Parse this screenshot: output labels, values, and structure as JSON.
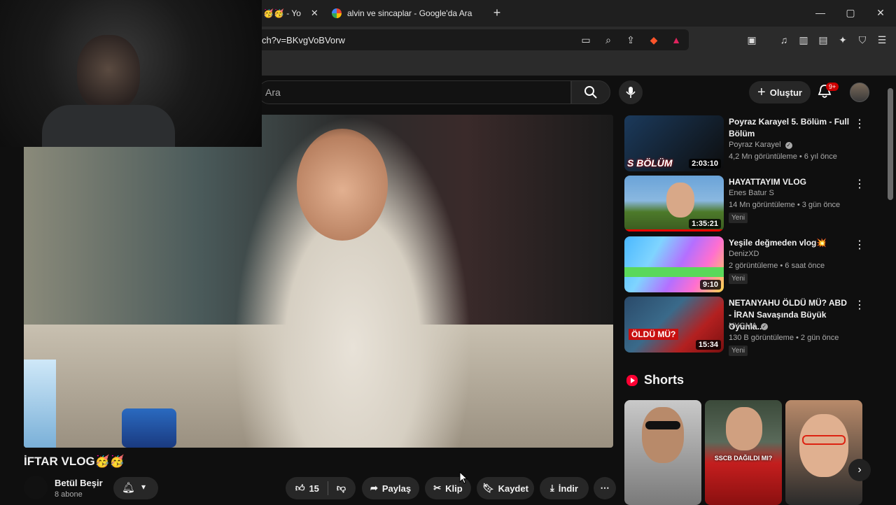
{
  "browser": {
    "tabs": [
      {
        "label": "🥳🥳 - Yo"
      },
      {
        "label": "alvin ve sincaplar - Google'da Ara"
      }
    ],
    "url": "ch?v=BKvgVoBVorw",
    "add_tab": "+",
    "window_controls": [
      "—",
      "▢",
      "✕"
    ]
  },
  "yt_header": {
    "search_placeholder": "Ara",
    "create_label": "Oluştur",
    "notif_count": "9+"
  },
  "video": {
    "title": "İFTAR VLOG🥳🥳",
    "channel": "Betül Beşir",
    "subscribers": "8 abone",
    "likes": "15",
    "actions": {
      "share": "Paylaş",
      "clip": "Klip",
      "save": "Kaydet",
      "download": "İndir"
    }
  },
  "recommendations": [
    {
      "title": "Poyraz Karayel 5. Bölüm - Full Bölüm",
      "channel": "Poyraz Karayel",
      "stats": "4,2 Mn görüntüleme • 6 yıl önce",
      "duration": "2:03:10",
      "new": "",
      "verified": true,
      "colors": [
        "#1b3a5c",
        "#0d0d0d"
      ]
    },
    {
      "title": "HAYATTAYIM VLOG",
      "channel": "Enes Batur S",
      "stats": "14 Mn görüntüleme • 3 gün önce",
      "duration": "1:35:21",
      "new": "Yeni",
      "verified": false,
      "colors": [
        "#6aa3d8",
        "#4d7a2a"
      ]
    },
    {
      "title": "Yeşile değmeden vlog💥",
      "channel": "DenizXD",
      "stats": "2 görüntüleme • 6 saat önce",
      "duration": "9:10",
      "new": "Yeni",
      "verified": false,
      "colors": [
        "#4ab8ff",
        "#b46fff"
      ]
    },
    {
      "title": "NETANYAHU ÖLDÜ MÜ? ABD - İRAN Savaşında Büyük Oyunla...",
      "channel": "NYGMA",
      "stats": "130 B görüntüleme • 2 gün önce",
      "duration": "15:34",
      "new": "Yeni",
      "verified": true,
      "colors": [
        "#2a4a6a",
        "#b32020"
      ]
    }
  ],
  "shorts": {
    "heading": "Shorts",
    "items": [
      {
        "caption": "",
        "colors": [
          "#c9c9c9",
          "#7a7a7a"
        ]
      },
      {
        "caption": "SSCB DAĞILDI MI?",
        "colors": [
          "#3b4a3a",
          "#c41e1e"
        ]
      },
      {
        "caption": "",
        "colors": [
          "#b88a6a",
          "#2a2a2a"
        ]
      }
    ]
  },
  "icons": {
    "search": "search-icon",
    "mic": "mic-icon",
    "bell": "bell-icon",
    "like": "thumbs-up-icon",
    "dislike": "thumbs-down-icon"
  }
}
